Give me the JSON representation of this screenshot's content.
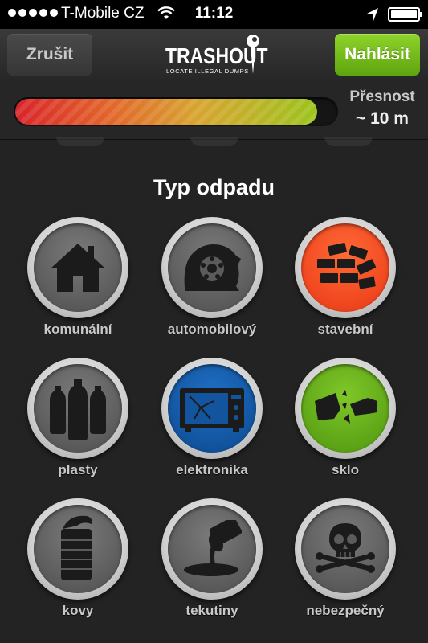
{
  "status_bar": {
    "carrier": "T-Mobile CZ",
    "time": "11:12",
    "signal_bars": 5,
    "icons": [
      "wifi-icon",
      "location-arrow-icon",
      "battery-icon"
    ]
  },
  "nav": {
    "cancel_label": "Zrušit",
    "report_label": "Nahlásit",
    "logo_wordmark": "TRASHOUT",
    "logo_tagline": "LOCATE ILLEGAL DUMPS"
  },
  "accuracy": {
    "label": "Přesnost",
    "value": "~ 10 m",
    "progress_fraction": 0.94
  },
  "section_title": "Typ odpadu",
  "categories": [
    {
      "label": "komunální",
      "icon": "house-icon",
      "state": "inactive"
    },
    {
      "label": "automobilový",
      "icon": "tire-icon",
      "state": "inactive"
    },
    {
      "label": "stavební",
      "icon": "bricks-icon",
      "state": "selected",
      "color": "#f0461f"
    },
    {
      "label": "plasty",
      "icon": "plastic-bottles-icon",
      "state": "inactive"
    },
    {
      "label": "elektronika",
      "icon": "microwave-icon",
      "state": "selected",
      "color": "#12549e"
    },
    {
      "label": "sklo",
      "icon": "broken-glass-icon",
      "state": "selected",
      "color": "#5ea517"
    },
    {
      "label": "kovy",
      "icon": "tin-can-icon",
      "state": "inactive"
    },
    {
      "label": "tekutiny",
      "icon": "spilled-liquid-icon",
      "state": "inactive"
    },
    {
      "label": "nebezpečný",
      "icon": "skull-icon",
      "state": "inactive"
    }
  ],
  "colors": {
    "accent_green": "#6cb51a",
    "background": "#232323",
    "selected_red": "#f0461f",
    "selected_blue": "#12549e",
    "selected_green": "#5ea517"
  }
}
